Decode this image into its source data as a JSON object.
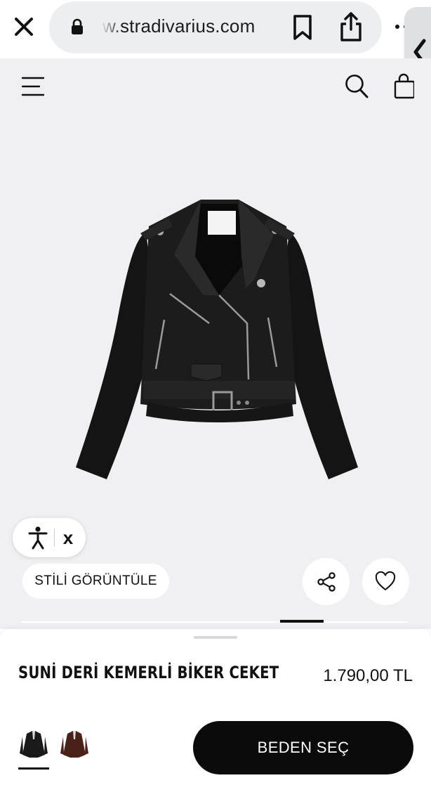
{
  "browser": {
    "url_text": "w.stradivarius.com",
    "icons": [
      "close-icon",
      "lock-icon",
      "bookmark-icon",
      "share-icon",
      "more-icon",
      "chevron-left-icon"
    ]
  },
  "header": {
    "icons": [
      "menu-icon",
      "search-icon",
      "shopping-bag-icon"
    ]
  },
  "accessibility": {
    "close_label": "x"
  },
  "actions": {
    "style_button_label": "STİLİ GÖRÜNTÜLE"
  },
  "product": {
    "name": "SUNİ DERİ KEMERLİ BİKER CEKET",
    "price": "1.790,00 TL",
    "size_button_label": "BEDEN SEÇ",
    "swatches": [
      {
        "color": "#1a1a1a",
        "selected": true
      },
      {
        "color": "#4a2119",
        "selected": false
      }
    ]
  },
  "colors": {
    "hero_background": "#f0f0f2",
    "button_dark": "#0b0b0b"
  }
}
